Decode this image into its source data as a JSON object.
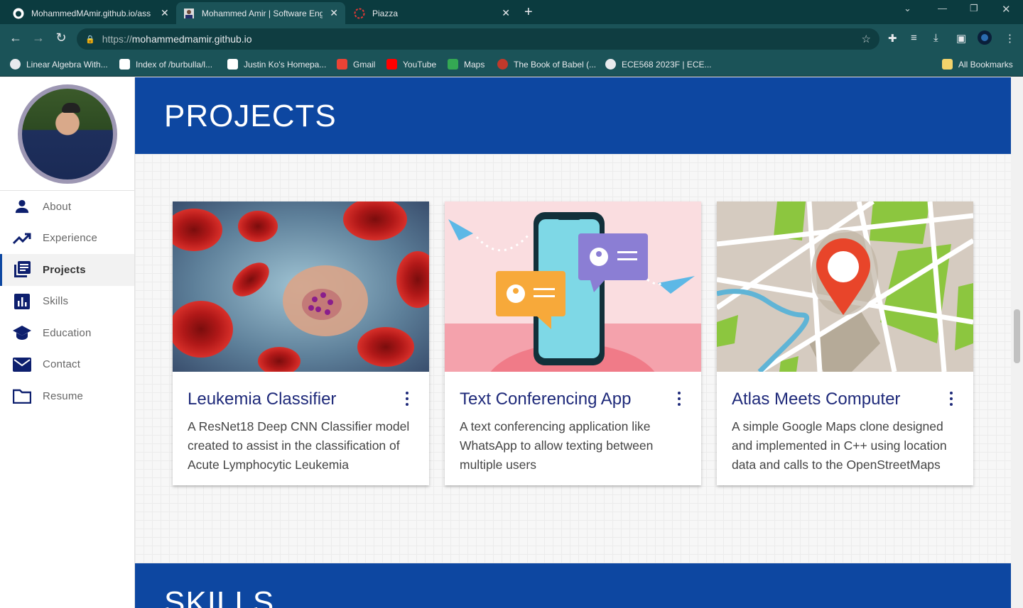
{
  "browser": {
    "tabs": [
      {
        "title": "MohammedMAmir.github.io/ass",
        "icon": "github-icon"
      },
      {
        "title": "Mohammed Amir | Software Eng",
        "icon": "portrait-icon"
      },
      {
        "title": "Piazza",
        "icon": "piazza-icon"
      }
    ],
    "url_protocol": "https://",
    "url_host": "mohammedmamir.github.io",
    "bookmarks": [
      {
        "label": "Linear Algebra With...",
        "color": "#e8eaed"
      },
      {
        "label": "Index of /burbulla/l...",
        "color": "#ffffff"
      },
      {
        "label": "Justin Ko's Homepa...",
        "color": "#ffffff"
      },
      {
        "label": "Gmail",
        "color": "#ea4335"
      },
      {
        "label": "YouTube",
        "color": "#ff0000"
      },
      {
        "label": "Maps",
        "color": "#34a853"
      },
      {
        "label": "The Book of Babel (...",
        "color": "#c0392b"
      },
      {
        "label": "ECE568 2023F | ECE...",
        "color": "#e8eaed"
      }
    ],
    "all_bookmarks": "All Bookmarks"
  },
  "sidebar": {
    "items": [
      {
        "label": "About",
        "icon": "person-icon",
        "active": false
      },
      {
        "label": "Experience",
        "icon": "trending-up-icon",
        "active": false
      },
      {
        "label": "Projects",
        "icon": "library-books-icon",
        "active": true
      },
      {
        "label": "Skills",
        "icon": "bar-chart-icon",
        "active": false
      },
      {
        "label": "Education",
        "icon": "graduation-cap-icon",
        "active": false
      },
      {
        "label": "Contact",
        "icon": "mail-icon",
        "active": false
      },
      {
        "label": "Resume",
        "icon": "folder-icon",
        "active": false
      }
    ]
  },
  "main": {
    "projects_title": "PROJECTS",
    "skills_title": "SKILLS",
    "cards": [
      {
        "title": "Leukemia Classifier",
        "description": "A ResNet18 Deep CNN Classifier model created to assist in the classification of Acute Lymphocytic Leukemia"
      },
      {
        "title": "Text Conferencing App",
        "description": "A text conferencing application like WhatsApp to allow texting between multiple users"
      },
      {
        "title": "Atlas Meets Computer",
        "description": "A simple Google Maps clone designed and implemented in C++ using location data and calls to the OpenStreetMaps API"
      }
    ]
  },
  "colors": {
    "accent": "#0d47a1",
    "card_title": "#1f2a7a",
    "chrome": "#1b5358"
  }
}
